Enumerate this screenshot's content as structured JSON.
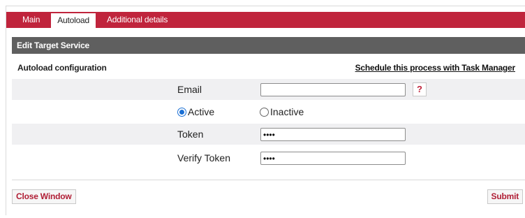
{
  "tabs": [
    {
      "label": "Main"
    },
    {
      "label": "Autoload"
    },
    {
      "label": "Additional details"
    }
  ],
  "section_title": "Edit Target Service",
  "subheader": {
    "title": "Autoload configuration",
    "link": "Schedule this process with Task Manager"
  },
  "form": {
    "email_label": "Email",
    "email_value": "",
    "help_glyph": "?",
    "status_options": [
      {
        "label": "Active",
        "selected": true
      },
      {
        "label": "Inactive",
        "selected": false
      }
    ],
    "token_label": "Token",
    "token_value": "••••",
    "verify_label": "Verify Token",
    "verify_value": "••••"
  },
  "buttons": {
    "close": "Close Window",
    "submit": "Submit"
  },
  "colors": {
    "tab_bar": "#c0243c",
    "section_header": "#5f5f5f",
    "button_text": "#b01e35",
    "radio_selected": "#1a6fd4"
  }
}
